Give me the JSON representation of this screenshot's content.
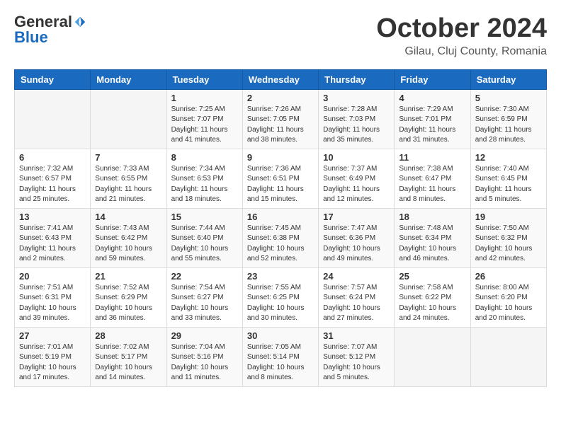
{
  "header": {
    "logo_general": "General",
    "logo_blue": "Blue",
    "month_title": "October 2024",
    "location": "Gilau, Cluj County, Romania"
  },
  "days_of_week": [
    "Sunday",
    "Monday",
    "Tuesday",
    "Wednesday",
    "Thursday",
    "Friday",
    "Saturday"
  ],
  "weeks": [
    [
      {
        "day": "",
        "info": ""
      },
      {
        "day": "",
        "info": ""
      },
      {
        "day": "1",
        "info": "Sunrise: 7:25 AM\nSunset: 7:07 PM\nDaylight: 11 hours and 41 minutes."
      },
      {
        "day": "2",
        "info": "Sunrise: 7:26 AM\nSunset: 7:05 PM\nDaylight: 11 hours and 38 minutes."
      },
      {
        "day": "3",
        "info": "Sunrise: 7:28 AM\nSunset: 7:03 PM\nDaylight: 11 hours and 35 minutes."
      },
      {
        "day": "4",
        "info": "Sunrise: 7:29 AM\nSunset: 7:01 PM\nDaylight: 11 hours and 31 minutes."
      },
      {
        "day": "5",
        "info": "Sunrise: 7:30 AM\nSunset: 6:59 PM\nDaylight: 11 hours and 28 minutes."
      }
    ],
    [
      {
        "day": "6",
        "info": "Sunrise: 7:32 AM\nSunset: 6:57 PM\nDaylight: 11 hours and 25 minutes."
      },
      {
        "day": "7",
        "info": "Sunrise: 7:33 AM\nSunset: 6:55 PM\nDaylight: 11 hours and 21 minutes."
      },
      {
        "day": "8",
        "info": "Sunrise: 7:34 AM\nSunset: 6:53 PM\nDaylight: 11 hours and 18 minutes."
      },
      {
        "day": "9",
        "info": "Sunrise: 7:36 AM\nSunset: 6:51 PM\nDaylight: 11 hours and 15 minutes."
      },
      {
        "day": "10",
        "info": "Sunrise: 7:37 AM\nSunset: 6:49 PM\nDaylight: 11 hours and 12 minutes."
      },
      {
        "day": "11",
        "info": "Sunrise: 7:38 AM\nSunset: 6:47 PM\nDaylight: 11 hours and 8 minutes."
      },
      {
        "day": "12",
        "info": "Sunrise: 7:40 AM\nSunset: 6:45 PM\nDaylight: 11 hours and 5 minutes."
      }
    ],
    [
      {
        "day": "13",
        "info": "Sunrise: 7:41 AM\nSunset: 6:43 PM\nDaylight: 11 hours and 2 minutes."
      },
      {
        "day": "14",
        "info": "Sunrise: 7:43 AM\nSunset: 6:42 PM\nDaylight: 10 hours and 59 minutes."
      },
      {
        "day": "15",
        "info": "Sunrise: 7:44 AM\nSunset: 6:40 PM\nDaylight: 10 hours and 55 minutes."
      },
      {
        "day": "16",
        "info": "Sunrise: 7:45 AM\nSunset: 6:38 PM\nDaylight: 10 hours and 52 minutes."
      },
      {
        "day": "17",
        "info": "Sunrise: 7:47 AM\nSunset: 6:36 PM\nDaylight: 10 hours and 49 minutes."
      },
      {
        "day": "18",
        "info": "Sunrise: 7:48 AM\nSunset: 6:34 PM\nDaylight: 10 hours and 46 minutes."
      },
      {
        "day": "19",
        "info": "Sunrise: 7:50 AM\nSunset: 6:32 PM\nDaylight: 10 hours and 42 minutes."
      }
    ],
    [
      {
        "day": "20",
        "info": "Sunrise: 7:51 AM\nSunset: 6:31 PM\nDaylight: 10 hours and 39 minutes."
      },
      {
        "day": "21",
        "info": "Sunrise: 7:52 AM\nSunset: 6:29 PM\nDaylight: 10 hours and 36 minutes."
      },
      {
        "day": "22",
        "info": "Sunrise: 7:54 AM\nSunset: 6:27 PM\nDaylight: 10 hours and 33 minutes."
      },
      {
        "day": "23",
        "info": "Sunrise: 7:55 AM\nSunset: 6:25 PM\nDaylight: 10 hours and 30 minutes."
      },
      {
        "day": "24",
        "info": "Sunrise: 7:57 AM\nSunset: 6:24 PM\nDaylight: 10 hours and 27 minutes."
      },
      {
        "day": "25",
        "info": "Sunrise: 7:58 AM\nSunset: 6:22 PM\nDaylight: 10 hours and 24 minutes."
      },
      {
        "day": "26",
        "info": "Sunrise: 8:00 AM\nSunset: 6:20 PM\nDaylight: 10 hours and 20 minutes."
      }
    ],
    [
      {
        "day": "27",
        "info": "Sunrise: 7:01 AM\nSunset: 5:19 PM\nDaylight: 10 hours and 17 minutes."
      },
      {
        "day": "28",
        "info": "Sunrise: 7:02 AM\nSunset: 5:17 PM\nDaylight: 10 hours and 14 minutes."
      },
      {
        "day": "29",
        "info": "Sunrise: 7:04 AM\nSunset: 5:16 PM\nDaylight: 10 hours and 11 minutes."
      },
      {
        "day": "30",
        "info": "Sunrise: 7:05 AM\nSunset: 5:14 PM\nDaylight: 10 hours and 8 minutes."
      },
      {
        "day": "31",
        "info": "Sunrise: 7:07 AM\nSunset: 5:12 PM\nDaylight: 10 hours and 5 minutes."
      },
      {
        "day": "",
        "info": ""
      },
      {
        "day": "",
        "info": ""
      }
    ]
  ]
}
